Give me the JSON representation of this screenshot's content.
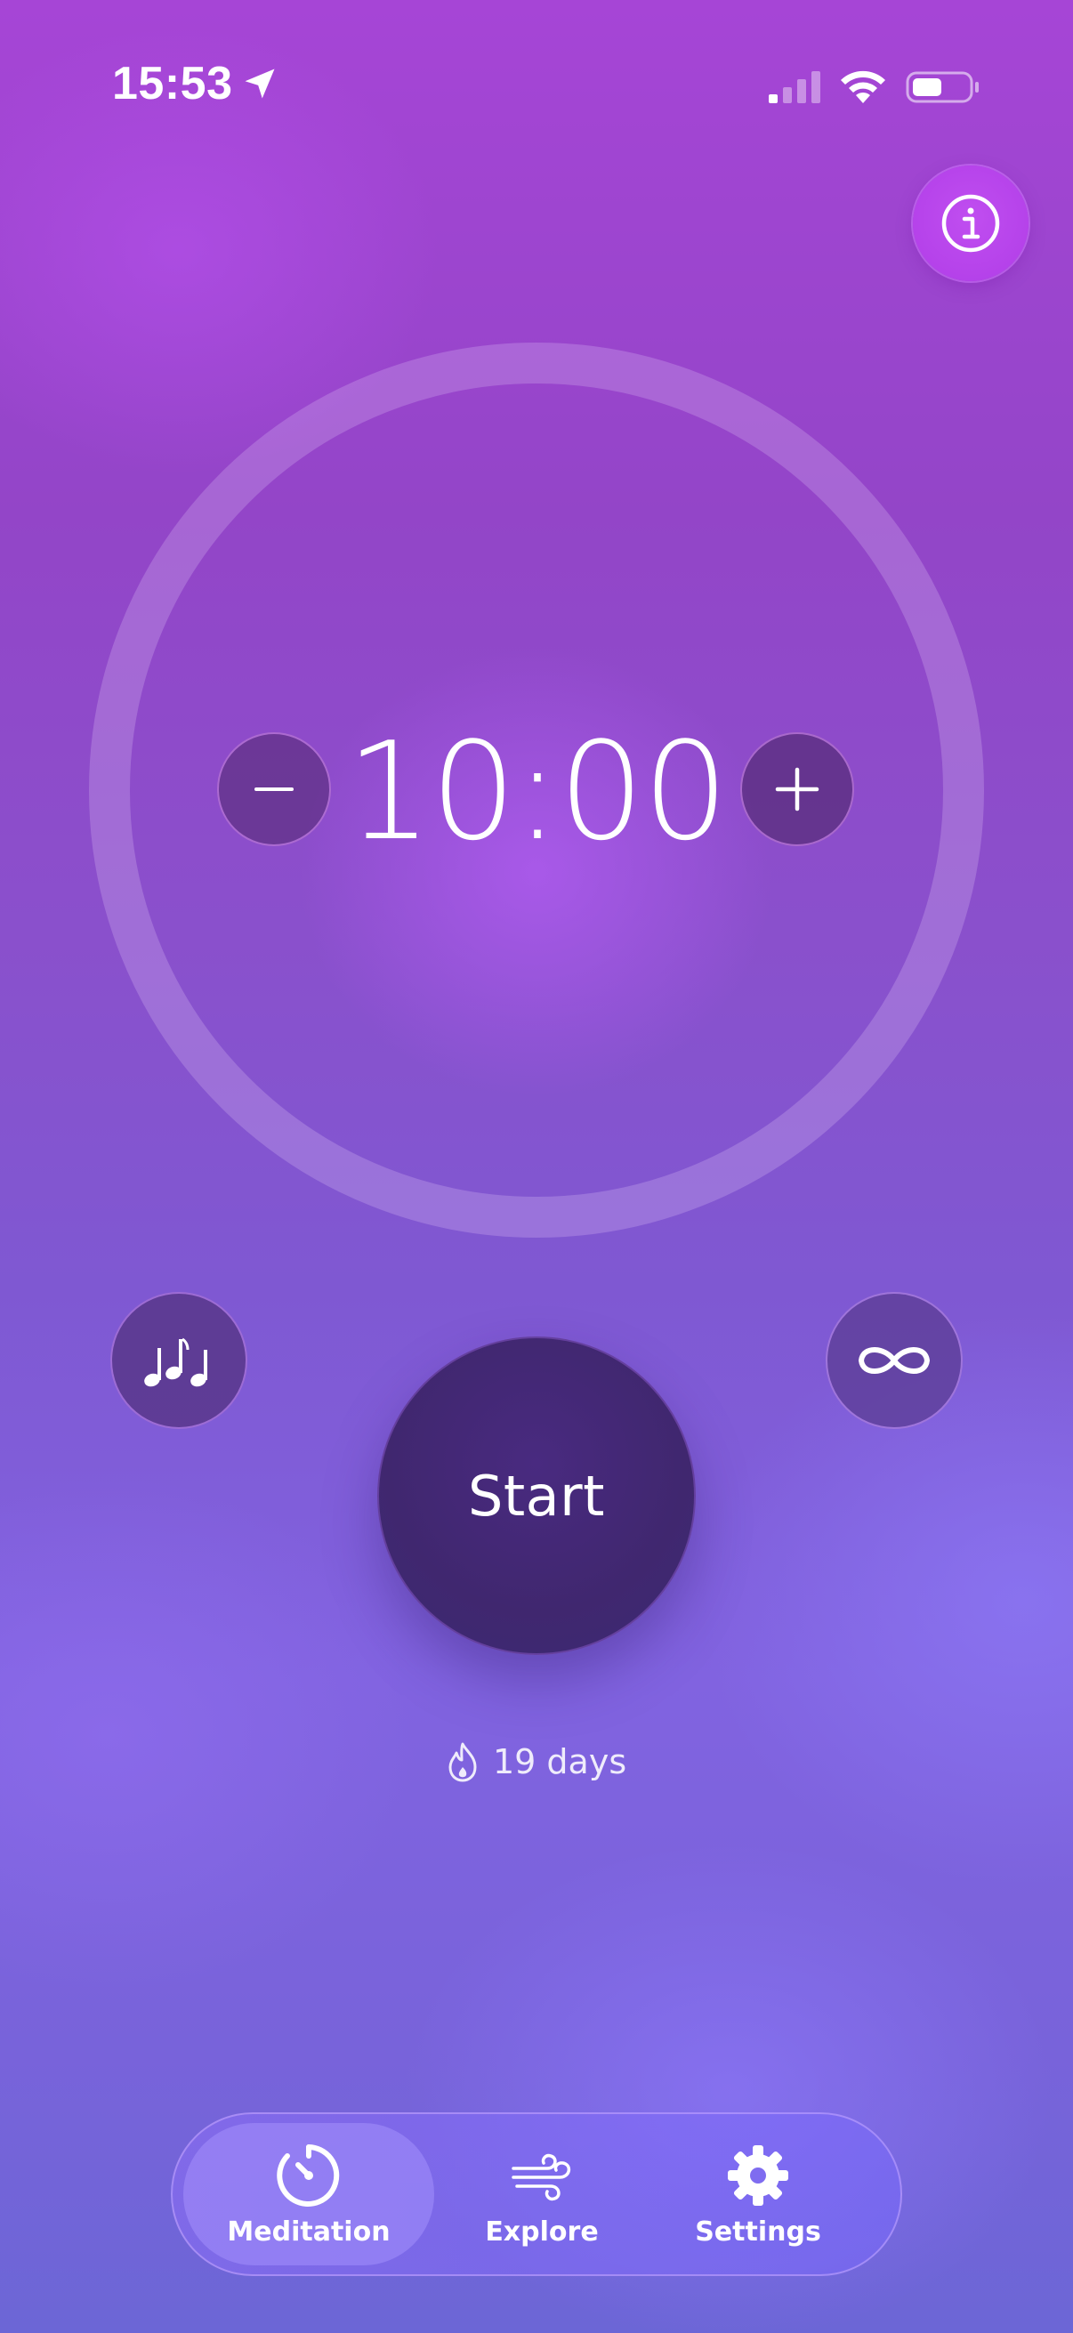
{
  "status_bar": {
    "time": "15:53",
    "icons": [
      "location-arrow-icon",
      "cellular-signal-icon",
      "wifi-icon",
      "battery-icon"
    ]
  },
  "header": {
    "info_icon": "info-icon"
  },
  "timer": {
    "display": "10:00",
    "decrement_icon": "minus-icon",
    "increment_icon": "plus-icon"
  },
  "controls": {
    "music_icon": "music-notes-icon",
    "loop_icon": "infinity-icon",
    "start_label": "Start"
  },
  "streak": {
    "icon": "flame-icon",
    "text": "19 days"
  },
  "tab_bar": {
    "tabs": [
      {
        "label": "Meditation",
        "icon": "timer-icon",
        "selected": true
      },
      {
        "label": "Explore",
        "icon": "wind-icon",
        "selected": false
      },
      {
        "label": "Settings",
        "icon": "gear-icon",
        "selected": false
      }
    ]
  },
  "colors": {
    "background_top": "#a645d6",
    "background_bottom": "#6c66d6",
    "start_button": "#40276f",
    "info_button": "#b542ea"
  }
}
